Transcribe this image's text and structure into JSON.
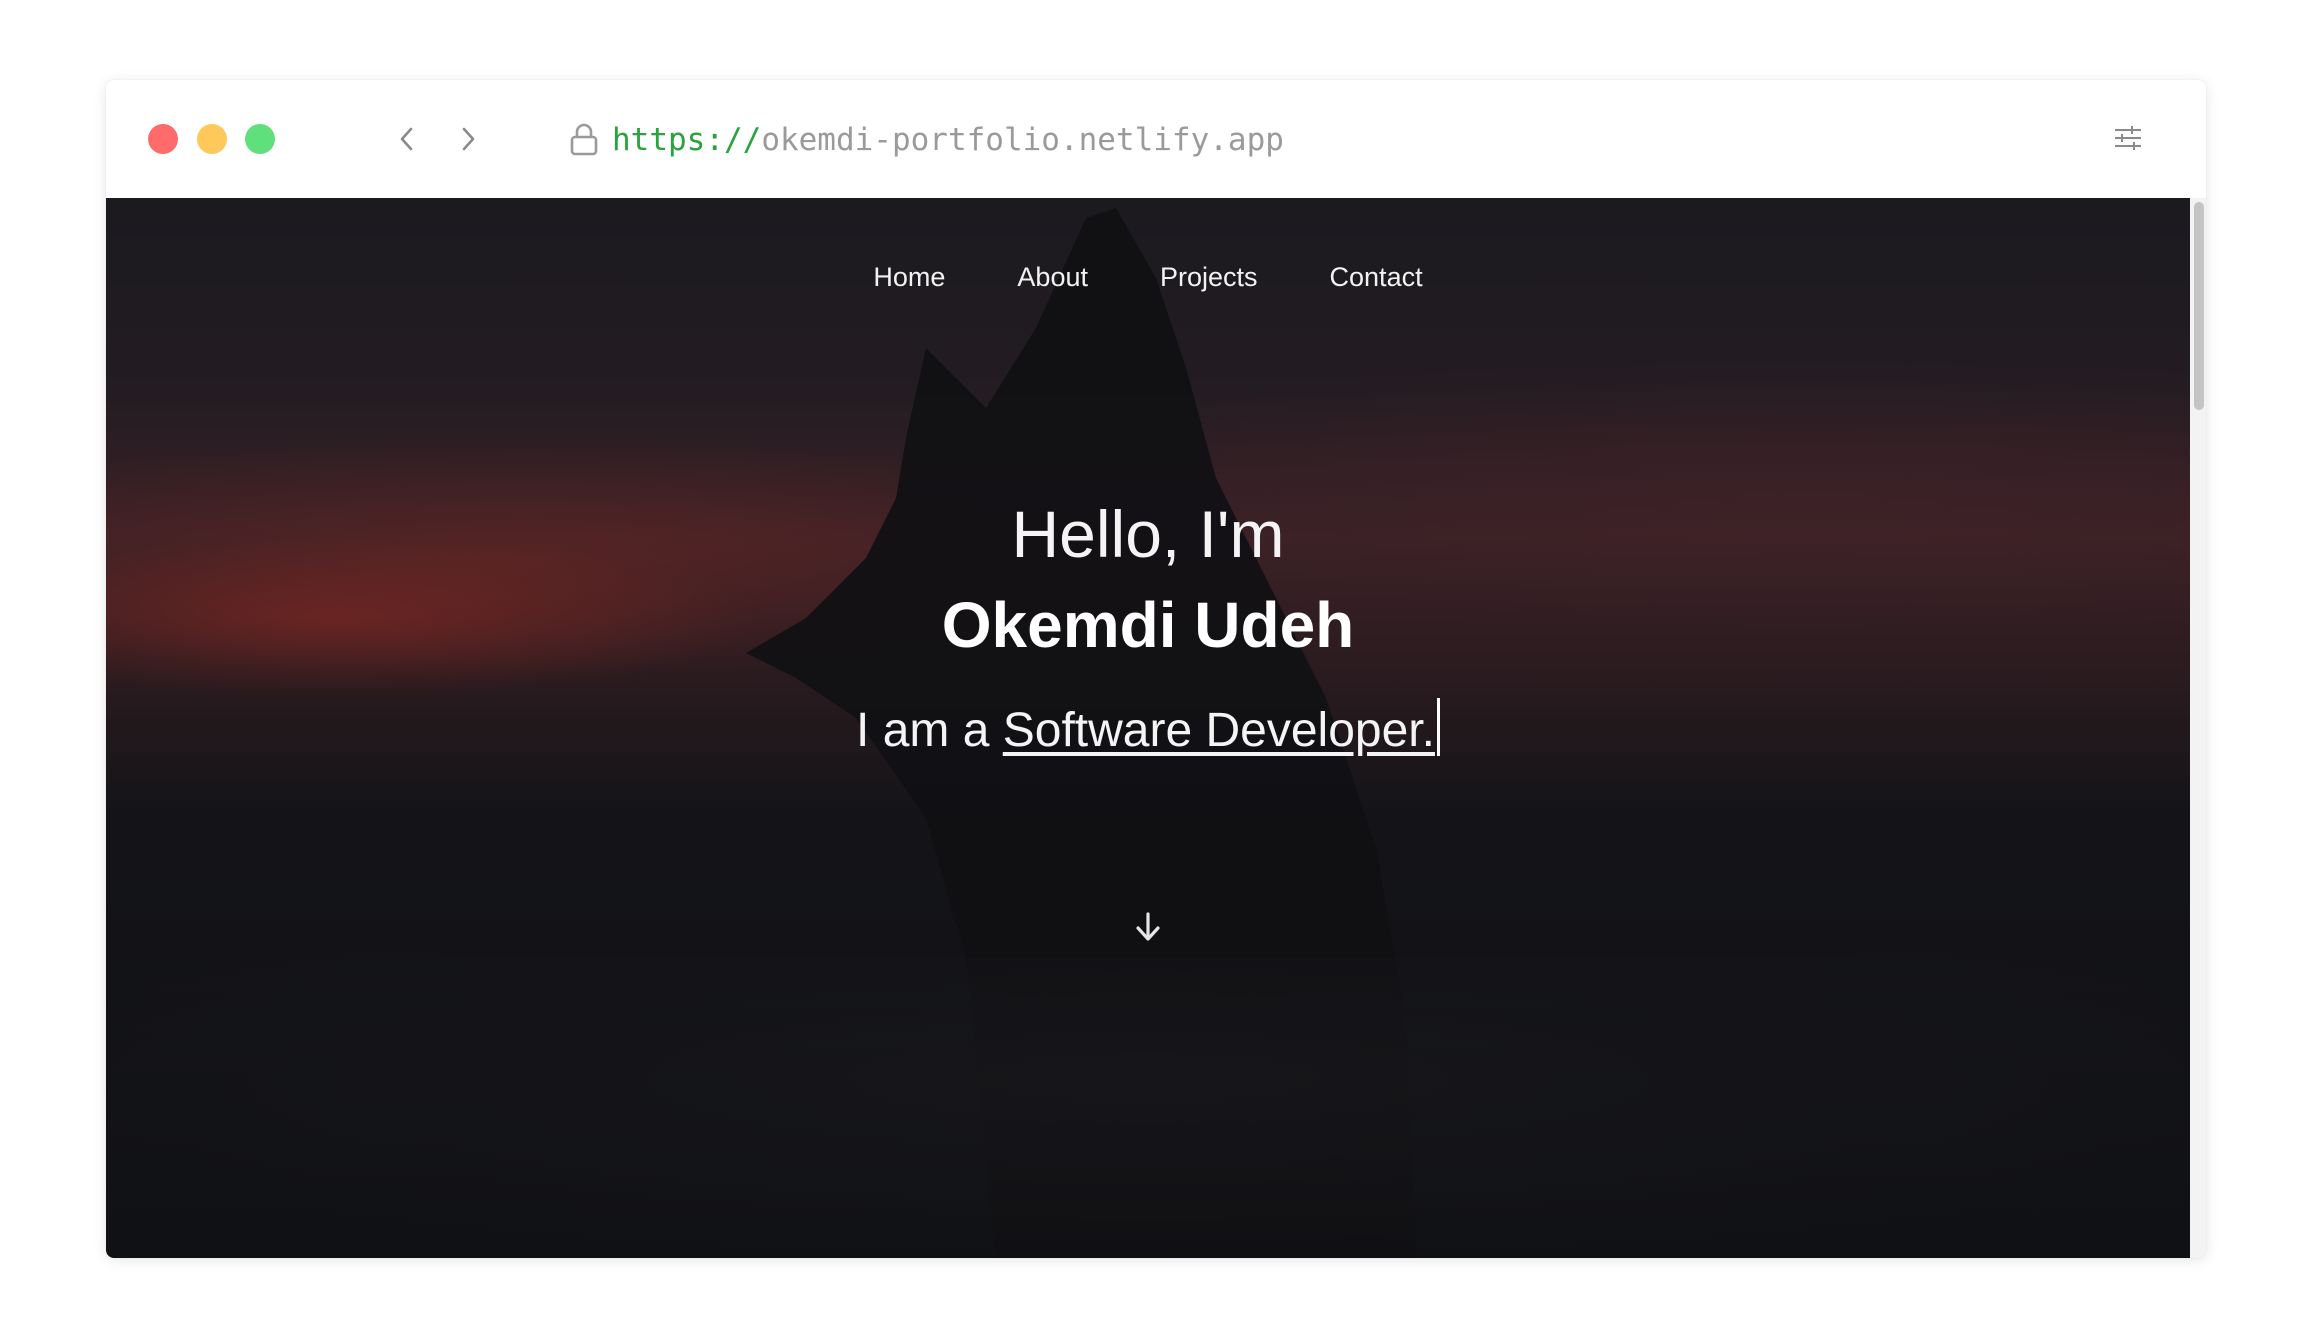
{
  "browser": {
    "url_scheme": "https://",
    "url_host": "okemdi-portfolio.netlify.app",
    "traffic_lights": {
      "close_color": "#ff6b6b",
      "minimize_color": "#ffc85a",
      "maximize_color": "#5fe07c"
    },
    "icons": {
      "back": "chevron-left-icon",
      "forward": "chevron-right-icon",
      "lock": "lock-icon",
      "settings": "sliders-icon"
    }
  },
  "site": {
    "nav": {
      "home": "Home",
      "about": "About",
      "projects": "Projects",
      "contact": "Contact"
    },
    "hero": {
      "greeting": "Hello, I'm",
      "name": "Okemdi Udeh",
      "tagline_prefix": "I am a ",
      "tagline_role": "Software Developer."
    },
    "scroll_icon": "arrow-down-icon"
  },
  "colors": {
    "url_scheme": "#2aa33e",
    "url_host": "#9a9a9a",
    "hero_text": "#ffffff"
  }
}
